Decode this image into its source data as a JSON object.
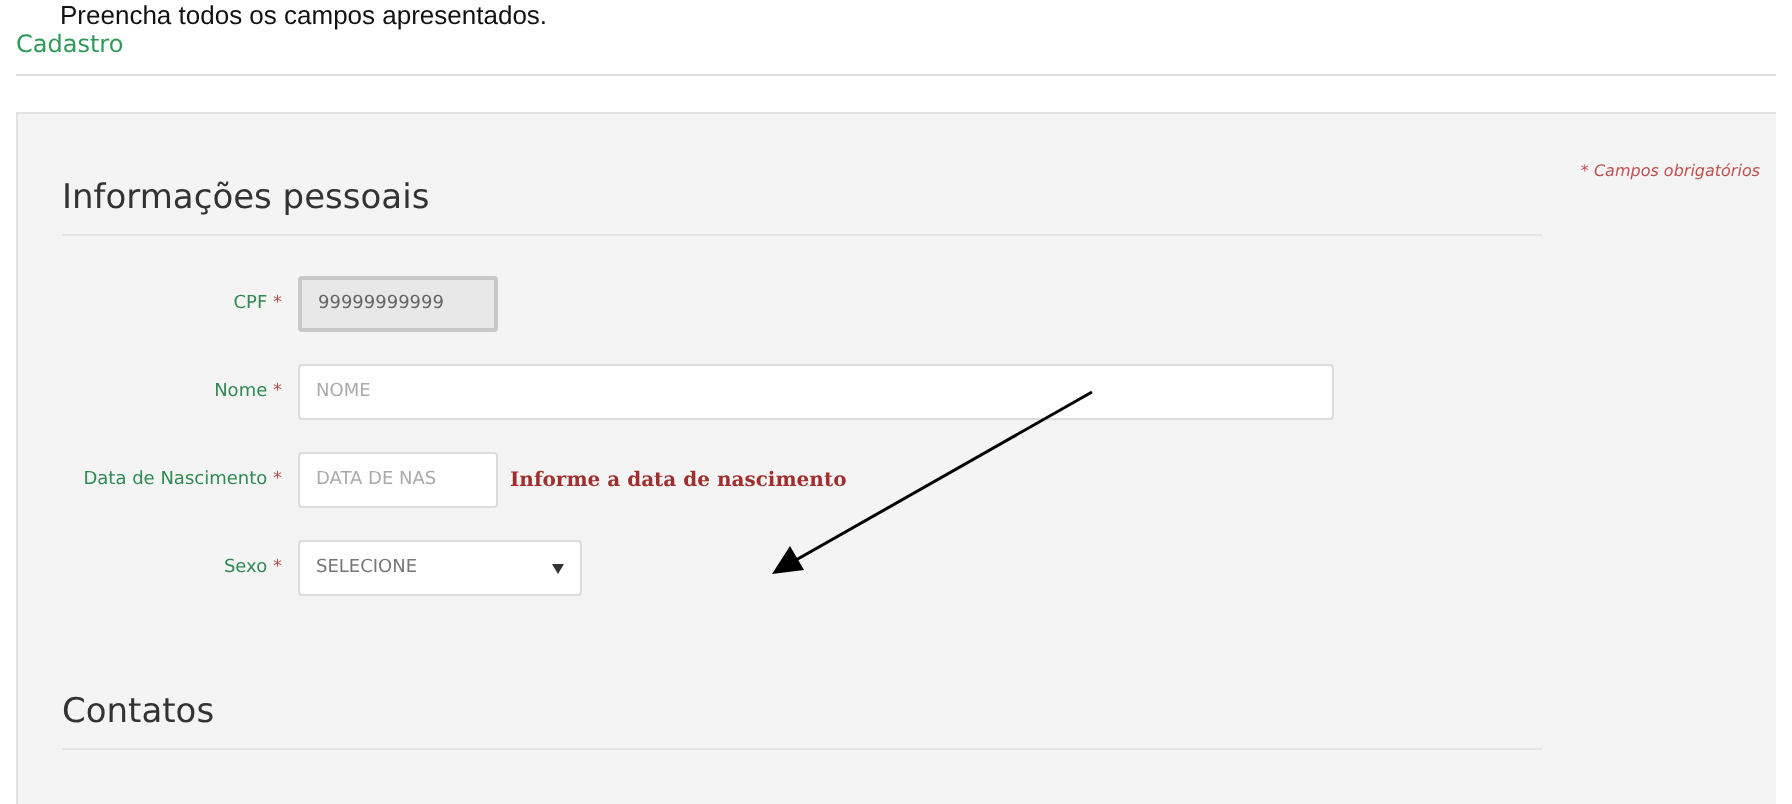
{
  "instruction": "Preencha todos os campos apresentados.",
  "breadcrumb": "Cadastro",
  "required_note": "* Campos obrigatórios",
  "sections": [
    {
      "title": "Informações pessoais",
      "fields": [
        {
          "kind": "text",
          "label": "CPF",
          "required_mark": "*",
          "value": "99999999999",
          "disabled": true
        },
        {
          "kind": "text",
          "label": "Nome",
          "required_mark": "*",
          "placeholder": "NOME",
          "disabled": false
        },
        {
          "kind": "text",
          "label": "Data de Nascimento",
          "required_mark": "*",
          "placeholder": "DATA DE NAS",
          "disabled": false,
          "error": "Informe a data de nascimento"
        },
        {
          "kind": "select",
          "label": "Sexo",
          "required_mark": "*",
          "value": "SELECIONE",
          "disabled": false
        }
      ]
    },
    {
      "title": "Contatos"
    }
  ]
}
